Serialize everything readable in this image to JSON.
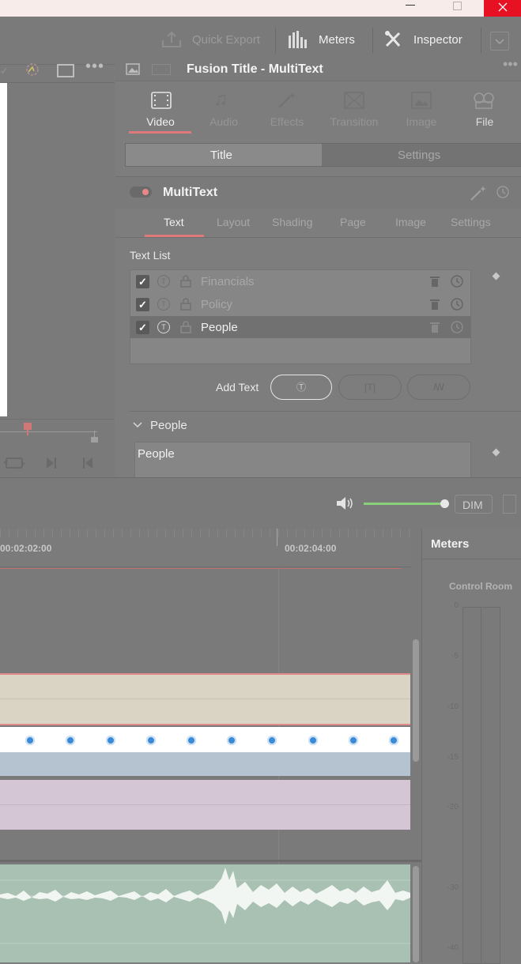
{
  "window": {
    "minimize_icon": "minimize-icon",
    "restore_icon": "restore-icon",
    "close_icon": "close-icon",
    "close_color": "#e81123"
  },
  "topbar": {
    "quick_export": "Quick Export",
    "meters": "Meters",
    "inspector": "Inspector"
  },
  "inspector": {
    "title": "Fusion Title - MultiText",
    "tabs": [
      {
        "label": "Video",
        "active": true
      },
      {
        "label": "Audio",
        "active": false
      },
      {
        "label": "Effects",
        "active": false
      },
      {
        "label": "Transition",
        "active": false
      },
      {
        "label": "Image",
        "active": false
      },
      {
        "label": "File",
        "active": false
      }
    ],
    "subtabs": {
      "title": "Title",
      "settings": "Settings"
    },
    "section_title": "MultiText",
    "text_tabs": [
      "Text",
      "Layout",
      "Shading",
      "Page",
      "Image",
      "Settings"
    ],
    "text_list_label": "Text List",
    "text_items": [
      {
        "name": "Financials",
        "checked": true,
        "selected": false
      },
      {
        "name": "Policy",
        "checked": true,
        "selected": false
      },
      {
        "name": "People",
        "checked": true,
        "selected": true
      }
    ],
    "add_text_label": "Add Text",
    "people_section": "People",
    "people_value": "People"
  },
  "audio": {
    "dim_label": "DIM",
    "volume_level": 0.98
  },
  "timeline": {
    "tc1": "00:02:02:00",
    "tc2": "00:02:04:00"
  },
  "meters": {
    "title": "Meters",
    "control_room": "Control Room",
    "scale": [
      "0",
      "-5",
      "-10",
      "-15",
      "-20",
      "-30",
      "-40"
    ]
  },
  "colors": {
    "accent": "#e07a7a",
    "track_tan": "#d9d4c4",
    "track_blue": "#b5c3d1",
    "track_purple": "#d5c6d6",
    "track_green": "#a9c1b2"
  }
}
